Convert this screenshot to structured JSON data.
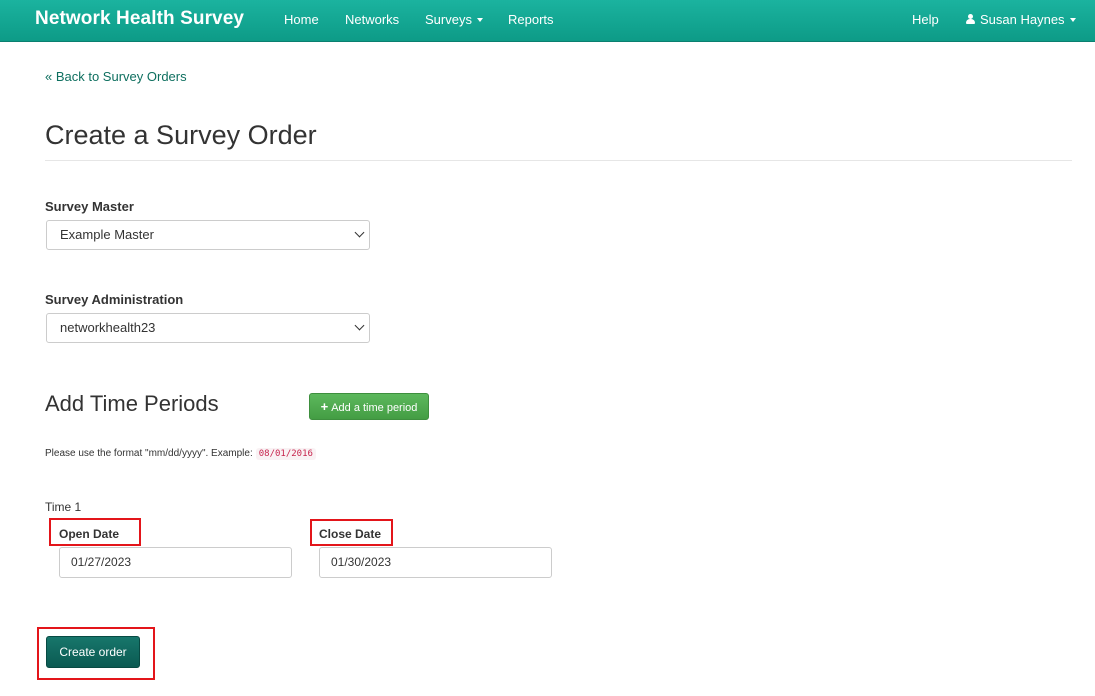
{
  "navbar": {
    "brand": "Network Health Survey",
    "links": [
      "Home",
      "Networks",
      "Surveys",
      "Reports"
    ],
    "help": "Help",
    "user": "Susan Haynes"
  },
  "back_link": "« Back to Survey Orders",
  "page_title": "Create a Survey Order",
  "survey_master": {
    "label": "Survey Master",
    "value": "Example Master"
  },
  "survey_administration": {
    "label": "Survey Administration",
    "value": "networkhealth23"
  },
  "time_periods": {
    "title": "Add Time Periods",
    "add_button": "Add a time period",
    "hint": "Please use the format \"mm/dd/yyyy\". Example:",
    "example": "08/01/2016",
    "time_label": "Time 1",
    "open_date_label": "Open Date",
    "open_date_value": "01/27/2023",
    "close_date_label": "Close Date",
    "close_date_value": "01/30/2023"
  },
  "create_button": "Create order",
  "colors": {
    "navbar": "#0d9b87",
    "add_button": "#5cb85c",
    "create_button": "#0b5a52",
    "highlight": "#e3151a"
  }
}
